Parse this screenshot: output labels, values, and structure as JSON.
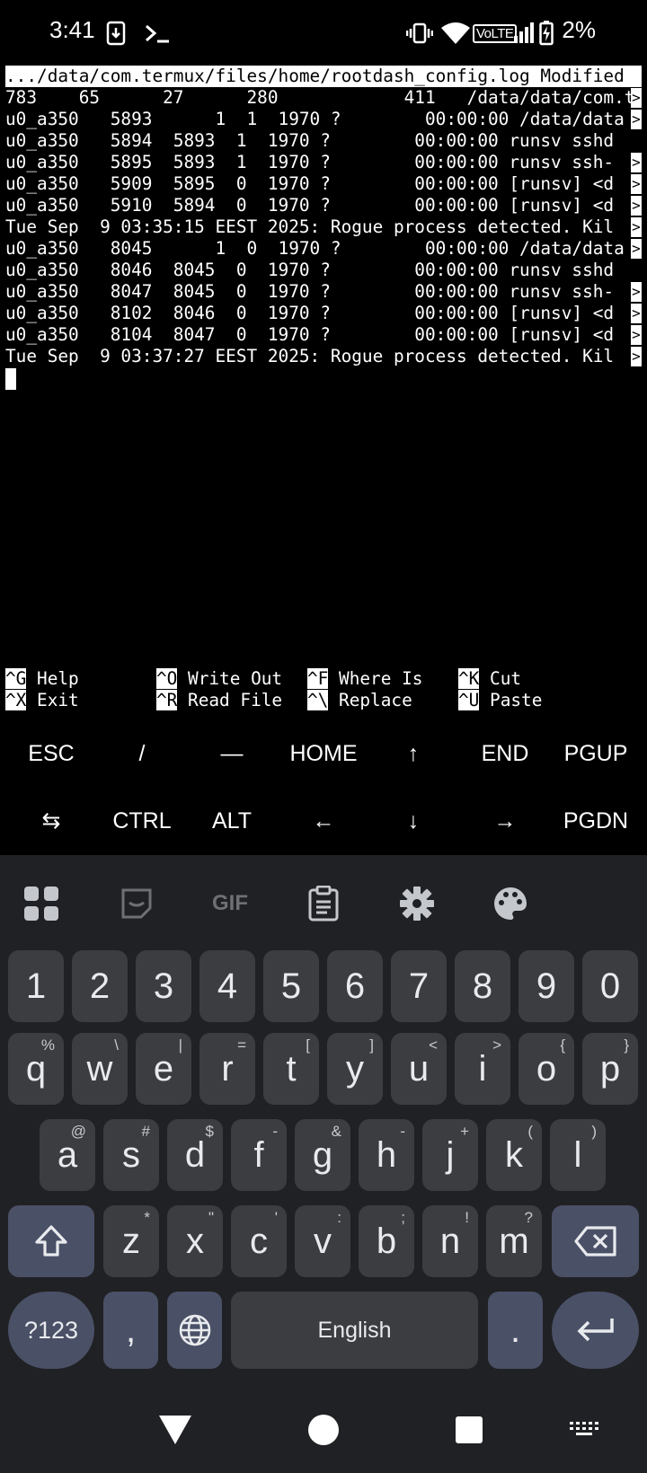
{
  "status_bar": {
    "time": "3:41",
    "battery": "2%",
    "volte": "VoLTE"
  },
  "terminal": {
    "header": ".../data/com.termux/files/home/rootdash_config.log Modified",
    "lines": [
      "783    65      27      280            411   /data/data/com.t",
      "u0_a350   5893      1  1  1970 ?        00:00:00 /data/data",
      "u0_a350   5894  5893  1  1970 ?        00:00:00 runsv sshd",
      "u0_a350   5895  5893  1  1970 ?        00:00:00 runsv ssh-",
      "u0_a350   5909  5895  0  1970 ?        00:00:00 [runsv] <d",
      "u0_a350   5910  5894  0  1970 ?        00:00:00 [runsv] <d",
      "Tue Sep  9 03:35:15 EEST 2025: Rogue process detected. Kil",
      "u0_a350   8045      1  0  1970 ?        00:00:00 /data/data",
      "u0_a350   8046  8045  0  1970 ?        00:00:00 runsv sshd",
      "u0_a350   8047  8045  0  1970 ?        00:00:00 runsv ssh-",
      "u0_a350   8102  8046  0  1970 ?        00:00:00 [runsv] <d",
      "u0_a350   8104  8047  0  1970 ?        00:00:00 [runsv] <d",
      "Tue Sep  9 03:37:27 EEST 2025: Rogue process detected. Kil"
    ],
    "overflow_marker": ">"
  },
  "nano_shortcuts": [
    {
      "key": "^G",
      "label": " Help"
    },
    {
      "key": "^O",
      "label": " Write Out"
    },
    {
      "key": "^F",
      "label": " Where Is"
    },
    {
      "key": "^K",
      "label": " Cut"
    },
    {
      "key": "^X",
      "label": " Exit"
    },
    {
      "key": "^R",
      "label": " Read File"
    },
    {
      "key": "^\\",
      "label": " Replace"
    },
    {
      "key": "^U",
      "label": " Paste"
    }
  ],
  "extra_keys": {
    "row1": [
      "ESC",
      "/",
      "—",
      "HOME",
      "↑",
      "END",
      "PGUP"
    ],
    "row2": [
      "⇆",
      "CTRL",
      "ALT",
      "←",
      "↓",
      "→",
      "PGDN"
    ]
  },
  "keyboard": {
    "toolbar_icons": [
      "apps-grid-icon",
      "sticker-icon",
      "gif-icon",
      "clipboard-icon",
      "settings-gear-icon",
      "palette-icon"
    ],
    "gif_label": "GIF",
    "number_row": [
      "1",
      "2",
      "3",
      "4",
      "5",
      "6",
      "7",
      "8",
      "9",
      "0"
    ],
    "row_q": [
      {
        "k": "q",
        "h": "%"
      },
      {
        "k": "w",
        "h": "\\"
      },
      {
        "k": "e",
        "h": "|"
      },
      {
        "k": "r",
        "h": "="
      },
      {
        "k": "t",
        "h": "["
      },
      {
        "k": "y",
        "h": "]"
      },
      {
        "k": "u",
        "h": "<"
      },
      {
        "k": "i",
        "h": ">"
      },
      {
        "k": "o",
        "h": "{"
      },
      {
        "k": "p",
        "h": "}"
      }
    ],
    "row_a": [
      {
        "k": "a",
        "h": "@"
      },
      {
        "k": "s",
        "h": "#"
      },
      {
        "k": "d",
        "h": "$"
      },
      {
        "k": "f",
        "h": "-"
      },
      {
        "k": "g",
        "h": "&"
      },
      {
        "k": "h",
        "h": "-"
      },
      {
        "k": "j",
        "h": "+"
      },
      {
        "k": "k",
        "h": "("
      },
      {
        "k": "l",
        "h": ")"
      }
    ],
    "row_z": [
      {
        "k": "z",
        "h": "*"
      },
      {
        "k": "x",
        "h": "\""
      },
      {
        "k": "c",
        "h": "'"
      },
      {
        "k": "v",
        "h": ":"
      },
      {
        "k": "b",
        "h": ";"
      },
      {
        "k": "n",
        "h": "!"
      },
      {
        "k": "m",
        "h": "?"
      }
    ],
    "symbols_label": "?123",
    "comma": ",",
    "space_label": "English",
    "period": "."
  }
}
